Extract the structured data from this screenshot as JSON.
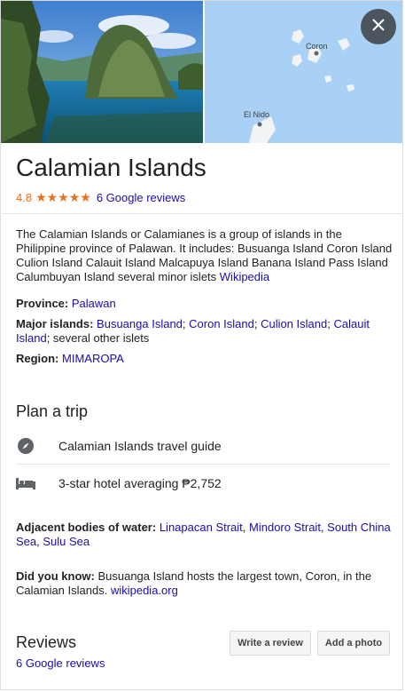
{
  "header": {
    "close_icon": "close-icon",
    "map_labels": {
      "coron": "Coron",
      "el_nido": "El Nido"
    }
  },
  "place": {
    "title": "Calamian Islands",
    "rating_value": "4.8",
    "stars": "★★★★★",
    "reviews_link": "6 Google reviews"
  },
  "description": {
    "text": "The Calamian Islands or Calamianes is a group of islands in the Philippine province of Palawan. It includes: Busuanga Island Coron Island Culion Island Calauit Island Malcapuya Island Banana Island Pass Island Calumbuyan Island several minor islets ",
    "source_link": "Wikipedia"
  },
  "facts": {
    "province_label": "Province:",
    "province_value": "Palawan",
    "major_islands_label": "Major islands:",
    "major_islands": [
      "Busuanga Island",
      "Coron Island",
      "Culion Island",
      "Calauit Island"
    ],
    "major_islands_suffix": "; several other islets",
    "region_label": "Region:",
    "region_value": "MIMAROPA"
  },
  "plan": {
    "heading": "Plan a trip",
    "travel_guide": "Calamian Islands travel guide",
    "hotel": "3-star hotel averaging ₱2,752"
  },
  "adjacent": {
    "label": "Adjacent bodies of water:",
    "items": [
      "Linapacan Strait",
      "Mindoro Strait",
      "South China Sea",
      "Sulu Sea"
    ]
  },
  "did_you_know": {
    "label": "Did you know:",
    "text": "Busuanga Island hosts the largest town, Coron, in the Calamian Islands. ",
    "source_link": "wikipedia.org"
  },
  "reviews": {
    "heading": "Reviews",
    "count_link": "6 Google reviews",
    "write_button": "Write a review",
    "photo_button": "Add a photo"
  },
  "colors": {
    "link": "#1a0dab",
    "star": "#e7711b",
    "map_water": "#a9d0f5"
  }
}
